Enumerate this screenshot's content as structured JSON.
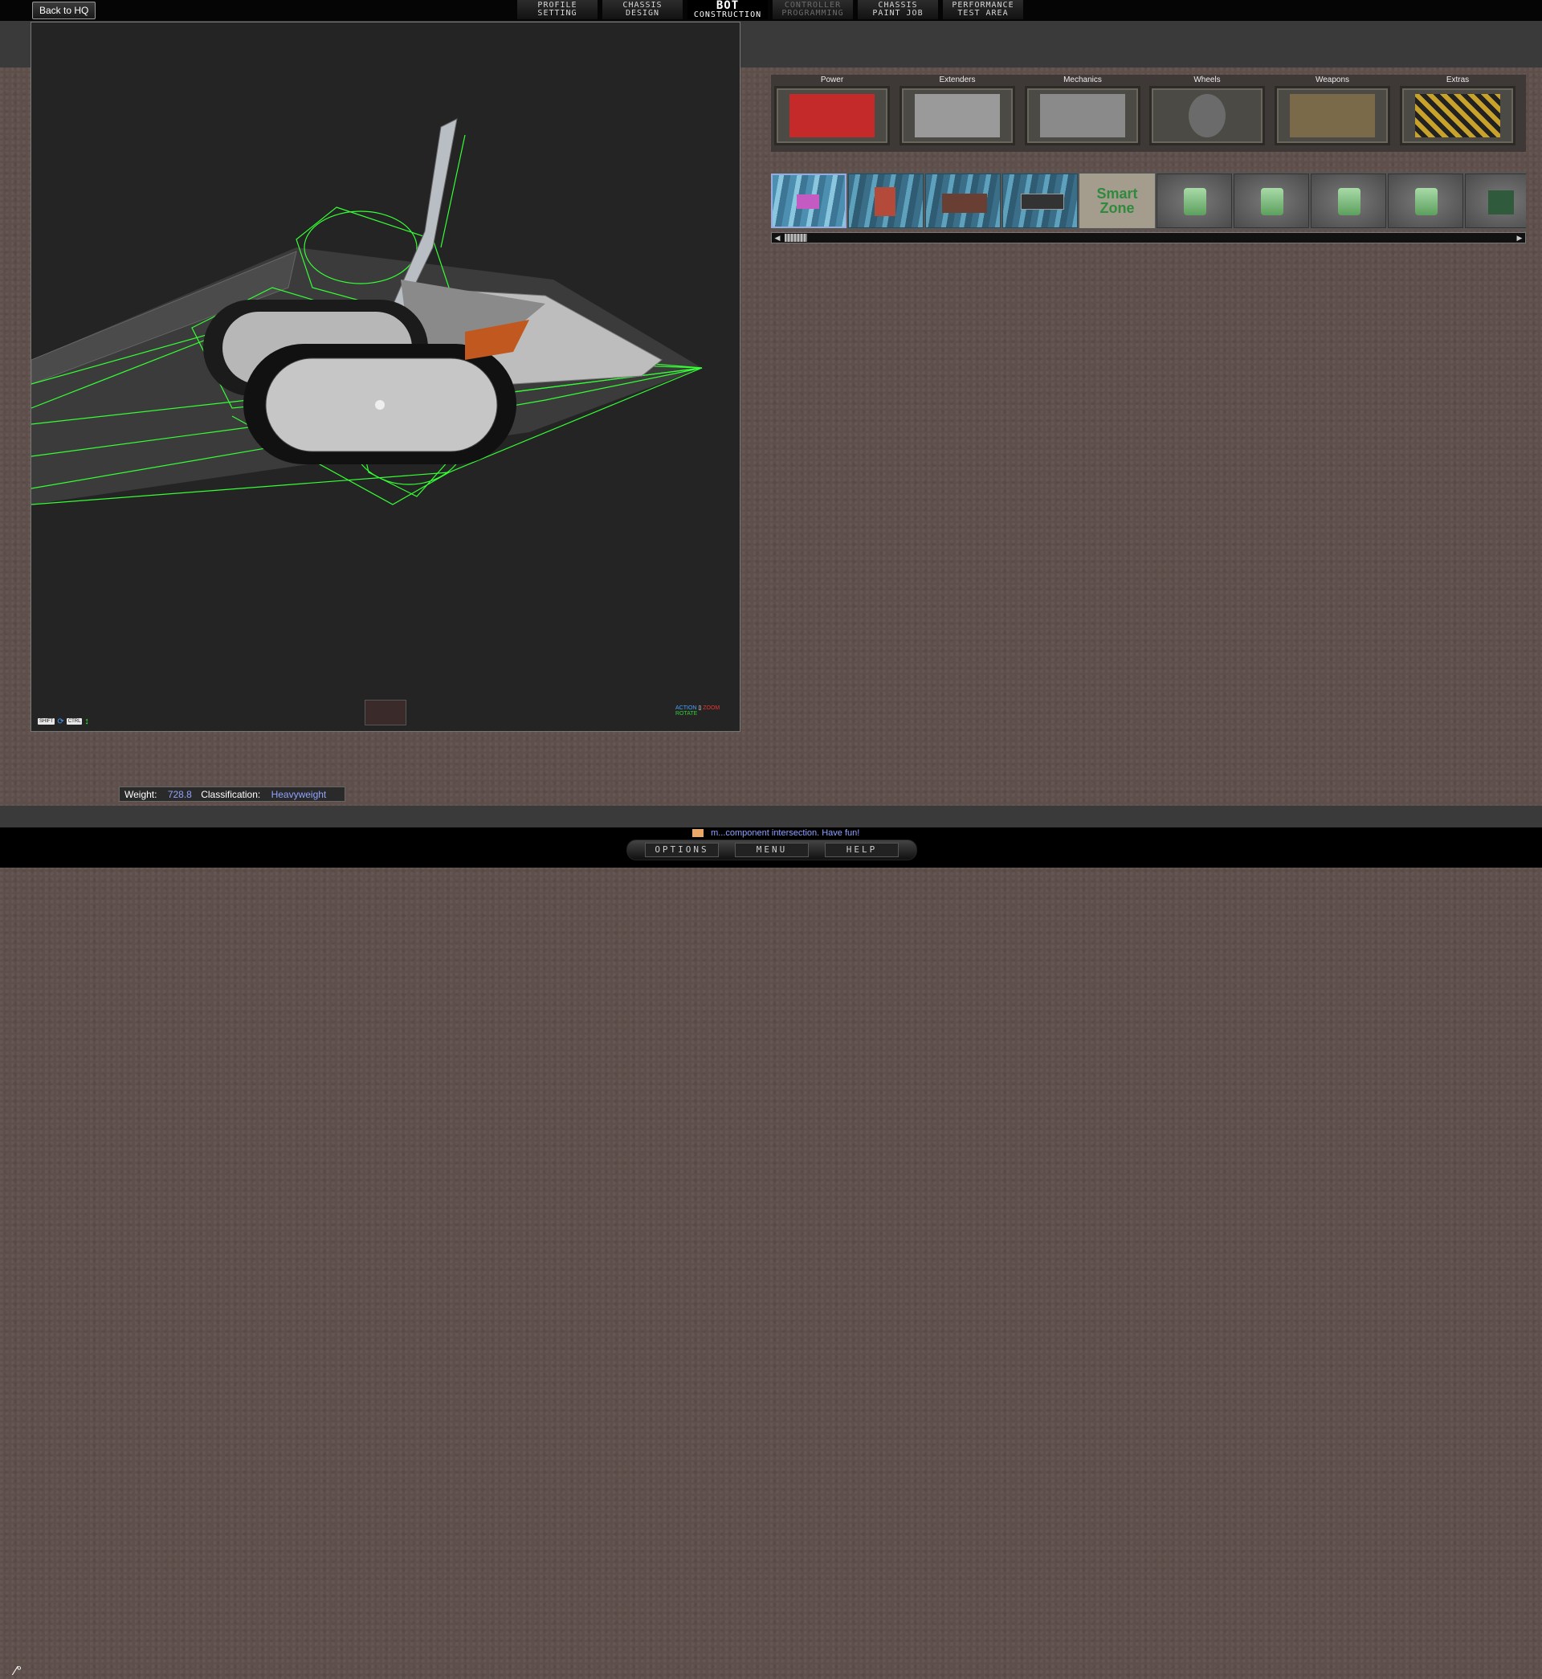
{
  "topbar": {
    "back_label": "Back to HQ",
    "tabs": [
      {
        "line1": "PROFILE",
        "line2": "SETTING",
        "state": "normal"
      },
      {
        "line1": "CHASSIS",
        "line2": "DESIGN",
        "state": "normal"
      },
      {
        "line1": "BOT",
        "line2": "CONSTRUCTION",
        "state": "active"
      },
      {
        "line1": "CONTROLLER",
        "line2": "PROGRAMMING",
        "state": "disabled"
      },
      {
        "line1": "CHASSIS",
        "line2": "PAINT JOB",
        "state": "normal"
      },
      {
        "line1": "PERFORMANCE",
        "line2": "TEST AREA",
        "state": "normal"
      }
    ]
  },
  "viewport": {
    "cam_help": {
      "shift": "SHIFT",
      "ctrl": "CTRL"
    },
    "mouse_help": {
      "action": "ACTION",
      "zoom": "ZOOM",
      "rotate": "ROTATE"
    }
  },
  "categories": [
    {
      "label": "Power",
      "icon": "battery-icon",
      "color": "#c52a2a"
    },
    {
      "label": "Extenders",
      "icon": "extender-bar-icon",
      "color": "#9a9a9a"
    },
    {
      "label": "Mechanics",
      "icon": "motor-icon",
      "color": "#8a8a8a"
    },
    {
      "label": "Wheels",
      "icon": "wheel-icon",
      "color": "#555555"
    },
    {
      "label": "Weapons",
      "icon": "blade-icon",
      "color": "#7a6a4a"
    },
    {
      "label": "Extras",
      "icon": "hazard-icon",
      "color": "#c9a22a"
    }
  ],
  "parts": {
    "smart_zone_line1": "Smart",
    "smart_zone_line2": "Zone"
  },
  "status": {
    "weight_label": "Weight:",
    "weight_value": "728.8",
    "class_label": "Classification:",
    "class_value": "Heavyweight"
  },
  "ticker": "m...component intersection. Have fun!",
  "menu": {
    "options": "OPTIONS",
    "menu": "MENU",
    "help": "HELP"
  },
  "colors": {
    "wireframe": "#34ff34",
    "accent": "#8fa2ff"
  }
}
